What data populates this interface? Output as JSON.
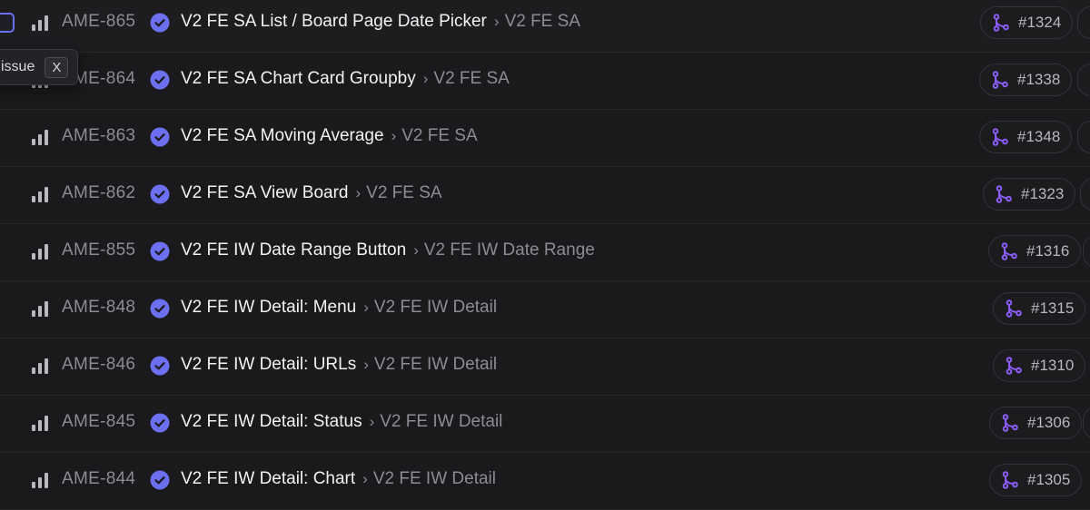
{
  "tooltip": {
    "text": "issue",
    "shortcut": "X"
  },
  "issues": [
    {
      "id": "AME-865",
      "title": "V2 FE SA List / Board Page Date Picker",
      "project": "V2 FE SA",
      "pr": "#1324"
    },
    {
      "id": "AME-864",
      "title": "V2 FE SA Chart Card Groupby",
      "project": "V2 FE SA",
      "pr": "#1338"
    },
    {
      "id": "AME-863",
      "title": "V2 FE SA Moving Average",
      "project": "V2 FE SA",
      "pr": "#1348"
    },
    {
      "id": "AME-862",
      "title": "V2 FE SA View Board",
      "project": "V2 FE SA",
      "pr": "#1323"
    },
    {
      "id": "AME-855",
      "title": "V2 FE IW Date Range Button",
      "project": "V2 FE IW Date Range",
      "pr": "#1316"
    },
    {
      "id": "AME-848",
      "title": "V2 FE IW Detail: Menu",
      "project": "V2 FE IW Detail",
      "pr": "#1315"
    },
    {
      "id": "AME-846",
      "title": "V2 FE IW Detail: URLs",
      "project": "V2 FE IW Detail",
      "pr": "#1310"
    },
    {
      "id": "AME-845",
      "title": "V2 FE IW Detail: Status",
      "project": "V2 FE IW Detail",
      "pr": "#1306"
    },
    {
      "id": "AME-844",
      "title": "V2 FE IW Detail: Chart",
      "project": "V2 FE IW Detail",
      "pr": "#1305"
    }
  ],
  "colors": {
    "status_done": "#6b6ff0",
    "pr_icon": "#8b5cf6"
  }
}
